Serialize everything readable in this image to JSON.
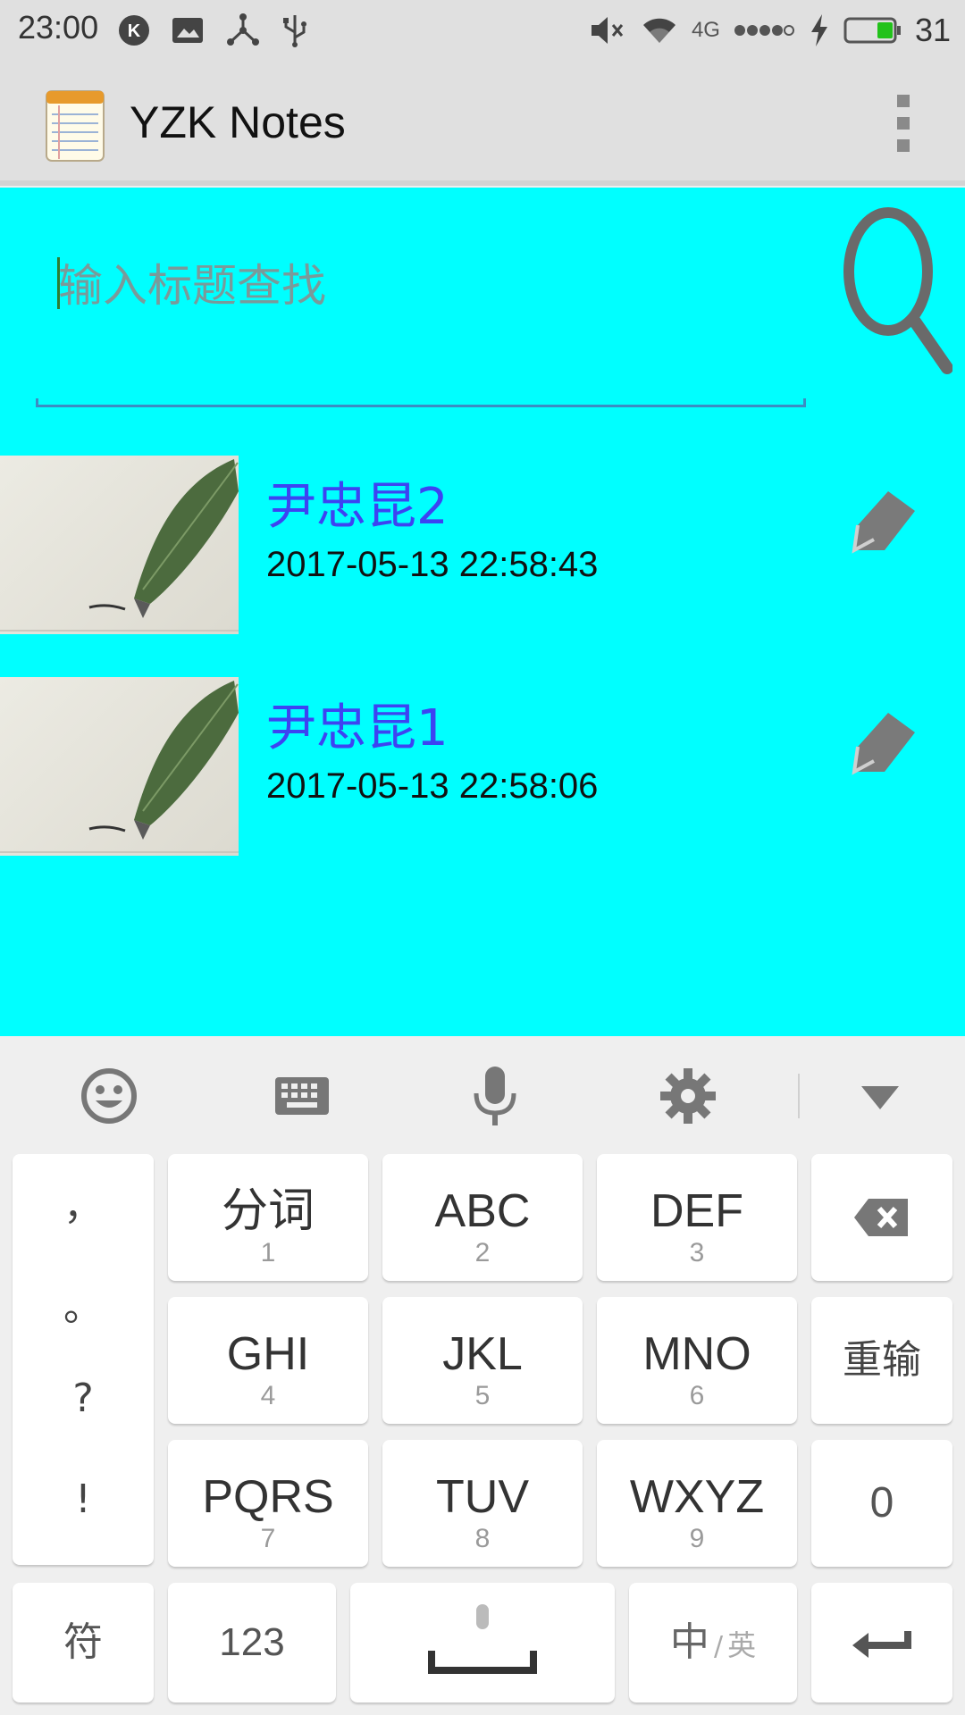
{
  "status_bar": {
    "time": "23:00",
    "network": "4G",
    "battery_level": "31"
  },
  "app_bar": {
    "title": "YZK Notes"
  },
  "search": {
    "placeholder": "输入标题查找",
    "value": ""
  },
  "notes": [
    {
      "title": "尹忠昆2",
      "date": "2017-05-13 22:58:43"
    },
    {
      "title": "尹忠昆1",
      "date": "2017-05-13 22:58:06"
    }
  ],
  "keyboard": {
    "toolbar": [
      "emoji-icon",
      "keyboard-icon",
      "microphone-icon",
      "gear-icon",
      "chevron-down-icon"
    ],
    "punctuation": [
      "，",
      "。",
      "?",
      "!"
    ],
    "rows": [
      [
        {
          "main": "分词",
          "sub": "1"
        },
        {
          "main": "ABC",
          "sub": "2"
        },
        {
          "main": "DEF",
          "sub": "3"
        }
      ],
      [
        {
          "main": "GHI",
          "sub": "4"
        },
        {
          "main": "JKL",
          "sub": "5"
        },
        {
          "main": "MNO",
          "sub": "6"
        }
      ],
      [
        {
          "main": "PQRS",
          "sub": "7"
        },
        {
          "main": "TUV",
          "sub": "8"
        },
        {
          "main": "WXYZ",
          "sub": "9"
        }
      ]
    ],
    "backspace": "backspace-icon",
    "reenter_label": "重输",
    "zero_label": "0",
    "symbols_label": "符",
    "numbers_label": "123",
    "lang_zh": "中",
    "lang_sep": "/",
    "lang_en": "英",
    "enter": "enter-icon"
  },
  "colors": {
    "content_bg": "#00ffff",
    "note_title": "#3d43f2",
    "appbar_bg": "#e0e0e0",
    "keyboard_bg": "#efefef"
  }
}
